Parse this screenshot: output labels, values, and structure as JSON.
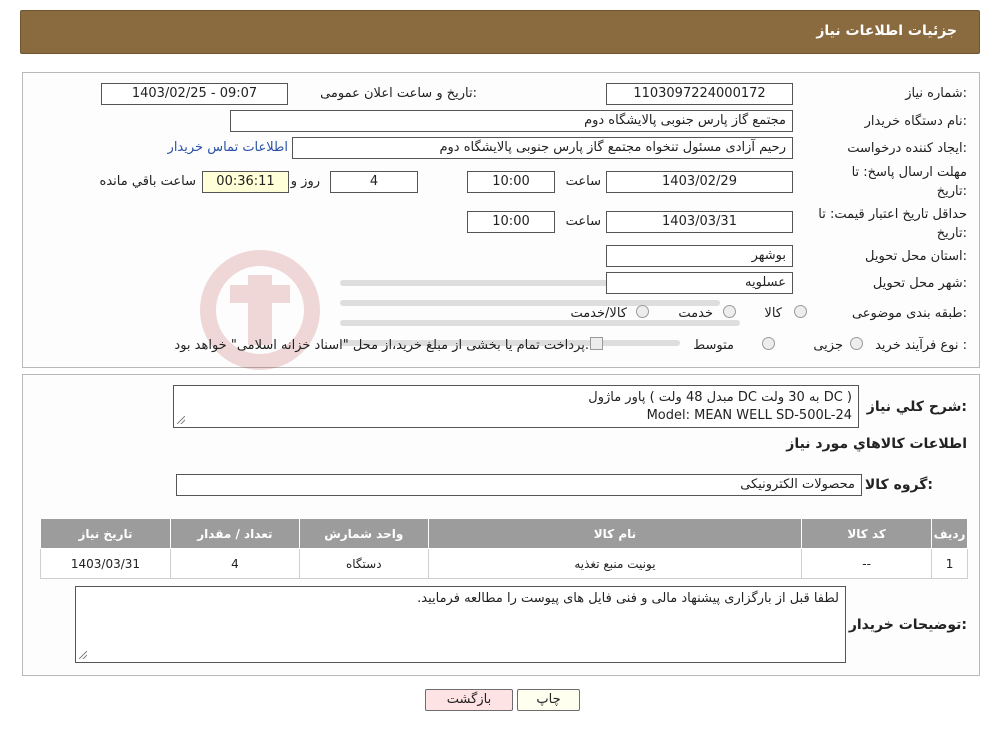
{
  "header": {
    "title": "جزئیات اطلاعات نیاز"
  },
  "details": {
    "need_number_label": "شماره نیاز:",
    "need_number": "1103097224000172",
    "announce_label": "تاریخ و ساعت اعلان عمومی:",
    "announce_value": "1403/02/25 - 09:07",
    "buyer_org_label": "نام دستگاه خریدار:",
    "buyer_org": "مجتمع گاز پارس جنوبی  پالایشگاه دوم",
    "creator_label": "ایجاد کننده درخواست:",
    "creator": "رحیم آزادی مسئول تنخواه مجتمع گاز پارس جنوبی  پالایشگاه دوم",
    "contact_link": "اطلاعات تماس خریدار",
    "deadline_label_1": "مهلت ارسال پاسخ: تا",
    "deadline_label_2": "تاریخ:",
    "deadline_date": "1403/02/29",
    "time_label": "ساعت",
    "deadline_time": "10:00",
    "days_value": "4",
    "days_label": "روز و",
    "remaining_value": "00:36:11",
    "remaining_label": "ساعت باقي مانده",
    "validity_label_1": "حداقل تاریخ اعتبار قیمت: تا",
    "validity_label_2": "تاریخ:",
    "validity_date": "1403/03/31",
    "validity_time": "10:00",
    "province_label": "استان محل تحویل:",
    "province": "بوشهر",
    "city_label": "شهر محل تحویل:",
    "city": "عسلویه",
    "category_label": "طبقه بندی موضوعی:",
    "category_options": [
      "کالا",
      "خدمت",
      "کالا/خدمت"
    ],
    "process_label": "نوع فرآیند خرید :",
    "process_options": [
      "جزیی",
      "متوسط"
    ],
    "process_note": "پرداخت تمام یا بخشی از مبلغ خرید،از محل \"اسناد خزانه اسلامی\" خواهد بود."
  },
  "description": {
    "label": "شرح کلي نياز:",
    "line1": "پاور ماژول ( مبدل 48 ولت DC  به 30 ولت DC )",
    "line2": "Model: MEAN WELL SD-500L-24"
  },
  "goods": {
    "section_title": "اطلاعات کالاهاي مورد نياز",
    "group_label": "گروه کالا:",
    "group_value": "محصولات الکترونیکی",
    "columns": [
      "رديف",
      "کد کالا",
      "نام کالا",
      "واحد شمارش",
      "تعداد / مقدار",
      "تاریخ نیاز"
    ],
    "rows": [
      [
        "1",
        "--",
        "یونیت منبع تغذیه",
        "دستگاه",
        "4",
        "1403/03/31"
      ]
    ]
  },
  "buyer_notes": {
    "label": "توضیحات خریدار:",
    "text": "لطفا قبل از بارگزاری پیشنهاد مالی و فنی فایل های پیوست را مطالعه فرمایید."
  },
  "buttons": {
    "print": "چاپ",
    "back": "بازگشت"
  },
  "colors": {
    "header": "#8a6a3f",
    "table_header": "#9c9c9c",
    "back_button": "#fde3e3"
  }
}
